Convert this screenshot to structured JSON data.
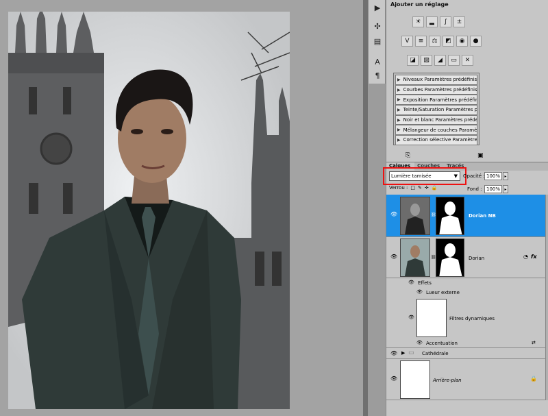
{
  "adjustments": {
    "title": "Ajouter un réglage",
    "icons_row1": [
      "brightness-icon",
      "levels-icon",
      "curves-icon",
      "exposure-icon"
    ],
    "icons_row2": [
      "vibrance-icon",
      "hue-saturation-icon",
      "color-balance-icon",
      "bw-icon",
      "photo-filter-icon",
      "channel-mixer-icon"
    ],
    "icons_row3": [
      "invert-icon",
      "posterize-icon",
      "threshold-icon",
      "gradient-map-icon",
      "selective-color-icon"
    ],
    "presets": [
      "Niveaux Paramètres prédéfinis",
      "Courbes Paramètres prédéfinis",
      "Exposition Paramètres prédéfinis",
      "Teinte/Saturation Paramètres pr...",
      "Noir et blanc Paramètres prédéfi...",
      "Mélangeur de couches Paramètr...",
      "Correction sélective Paramètres ..."
    ]
  },
  "layers_panel": {
    "tabs": [
      "Calques",
      "Couches",
      "Tracés"
    ],
    "blend_mode": "Lumière tamisée",
    "opacity_label": "Opacité :",
    "opacity_value": "100%",
    "lock_label": "Verrou :",
    "fill_label": "Fond :",
    "fill_value": "100%",
    "layers": {
      "dorian_nb": "Dorian NB",
      "dorian": "Dorian",
      "effects": "Effets",
      "outer_glow": "Lueur externe",
      "smart_filters": "Filtres dynamiques",
      "sharpen": "Accentuation",
      "cathedral": "Cathédrale",
      "background": "Arrière-plan"
    },
    "fx_label": "fx"
  },
  "colors": {
    "selected_layer": "#1e8fe6",
    "highlight_box": "#e11111"
  }
}
